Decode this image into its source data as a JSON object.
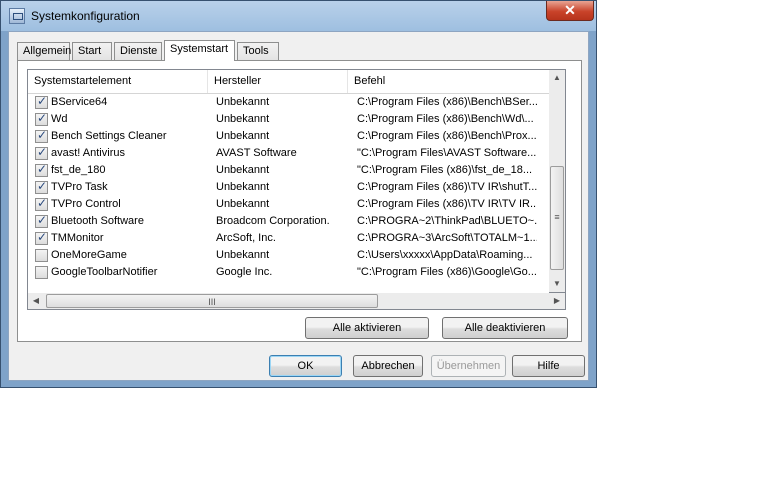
{
  "window": {
    "title": "Systemkonfiguration",
    "close_label": "✕"
  },
  "tabs": [
    {
      "label": "Allgemein"
    },
    {
      "label": "Start"
    },
    {
      "label": "Dienste"
    },
    {
      "label": "Systemstart"
    },
    {
      "label": "Tools"
    }
  ],
  "active_tab": "Systemstart",
  "table": {
    "columns": [
      "Systemstartelement",
      "Hersteller",
      "Befehl"
    ],
    "rows": [
      {
        "checked": true,
        "name": "BService64",
        "vendor": "Unbekannt",
        "command": "C:\\Program Files (x86)\\Bench\\BSer..."
      },
      {
        "checked": true,
        "name": "Wd",
        "vendor": "Unbekannt",
        "command": "C:\\Program Files (x86)\\Bench\\Wd\\..."
      },
      {
        "checked": true,
        "name": "Bench Settings Cleaner",
        "vendor": "Unbekannt",
        "command": "C:\\Program Files (x86)\\Bench\\Prox..."
      },
      {
        "checked": true,
        "name": "avast! Antivirus",
        "vendor": "AVAST Software",
        "command": "\"C:\\Program Files\\AVAST Software..."
      },
      {
        "checked": true,
        "name": "fst_de_180",
        "vendor": "Unbekannt",
        "command": "\"C:\\Program Files (x86)\\fst_de_18..."
      },
      {
        "checked": true,
        "name": "TVPro Task",
        "vendor": "Unbekannt",
        "command": "C:\\Program Files (x86)\\TV IR\\shutT..."
      },
      {
        "checked": true,
        "name": "TVPro Control",
        "vendor": "Unbekannt",
        "command": "C:\\Program Files (x86)\\TV IR\\TV IR..."
      },
      {
        "checked": true,
        "name": "Bluetooth Software",
        "vendor": "Broadcom Corporation.",
        "command": "C:\\PROGRA~2\\ThinkPad\\BLUETO~..."
      },
      {
        "checked": true,
        "name": "TMMonitor",
        "vendor": "ArcSoft, Inc.",
        "command": "C:\\PROGRA~3\\ArcSoft\\TOTALM~1..."
      },
      {
        "checked": false,
        "name": "OneMoreGame",
        "vendor": "Unbekannt",
        "command": "C:\\Users\\xxxxx\\AppData\\Roaming..."
      },
      {
        "checked": false,
        "name": "GoogleToolbarNotifier",
        "vendor": "Google Inc.",
        "command": "\"C:\\Program Files (x86)\\Google\\Go..."
      }
    ]
  },
  "scrollbars": {
    "up": "▲",
    "down": "▼",
    "left": "◀",
    "right": "▶",
    "vgrip": "≡",
    "hgrip": "III"
  },
  "buttons": {
    "enable_all": "Alle aktivieren",
    "disable_all": "Alle deaktivieren",
    "ok": "OK",
    "cancel": "Abbrechen",
    "apply": "Übernehmen",
    "help": "Hilfe"
  },
  "check_glyph": "✓"
}
